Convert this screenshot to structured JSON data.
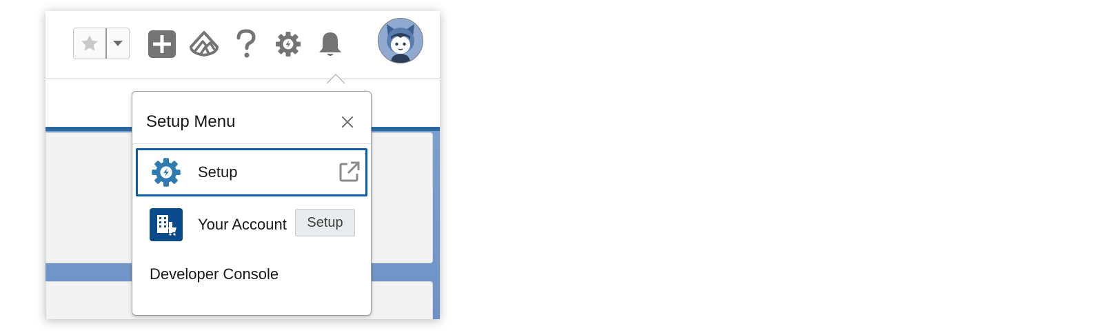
{
  "header": {
    "icons": [
      "star-icon",
      "chevron-down-icon",
      "add-icon",
      "trailhead-icon",
      "help-icon",
      "setup-gear-icon",
      "notification-bell-icon",
      "user-avatar"
    ],
    "colors": {
      "icon_gray": "#706e6b",
      "avatar_bg": "#8fa9d0"
    }
  },
  "setup_menu": {
    "title": "Setup Menu",
    "close_icon": "close-icon",
    "items": [
      {
        "label": "Setup",
        "icon": "setup-gear-icon",
        "trailing_icon": "external-link-icon",
        "focused": true
      },
      {
        "label": "Your Account",
        "icon": "account-building-icon"
      },
      {
        "label": "Developer Console"
      }
    ],
    "colors": {
      "focus_border": "#0b5cab",
      "setup_icon": "#2e7bb0",
      "account_icon": "#0b4a8b"
    }
  },
  "tooltip": {
    "text": "Setup"
  },
  "background": {
    "accent": "#2a6aa3",
    "banner": "#7c9fcf"
  }
}
